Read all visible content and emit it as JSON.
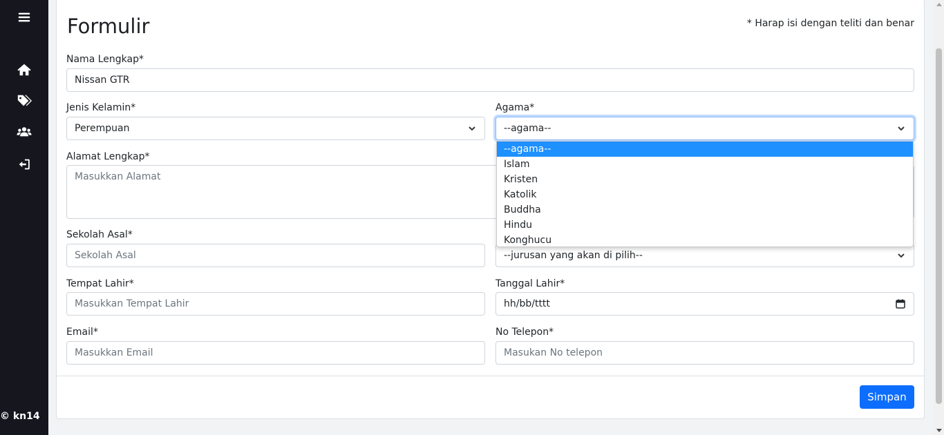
{
  "sidebar": {
    "icons": [
      "menu-icon",
      "home-icon",
      "tags-icon",
      "users-icon",
      "logout-icon"
    ],
    "copyright": "© kn14"
  },
  "form": {
    "title": "Formulir",
    "note": "* Harap isi dengan teliti dan benar",
    "nama": {
      "label": "Nama Lengkap*",
      "value": "Nissan GTR"
    },
    "jenis_kelamin": {
      "label": "Jenis Kelamin*",
      "value": "Perempuan"
    },
    "agama": {
      "label": "Agama*",
      "value": "--agama--",
      "options": [
        "--agama--",
        "Islam",
        "Kristen",
        "Katolik",
        "Buddha",
        "Hindu",
        "Konghucu"
      ],
      "selected_index": 0
    },
    "alamat": {
      "label": "Alamat Lengkap*",
      "placeholder": "Masukkan Alamat"
    },
    "sekolah": {
      "label": "Sekolah Asal*",
      "placeholder": "Sekolah Asal"
    },
    "jurusan": {
      "value": "--jurusan yang akan di pilih--"
    },
    "tempat_lahir": {
      "label": "Tempat Lahir*",
      "placeholder": "Masukkan Tempat Lahir"
    },
    "tanggal_lahir": {
      "label": "Tanggal Lahir*",
      "value": "hh/bb/tttt"
    },
    "email": {
      "label": "Email*",
      "placeholder": "Masukkan Email"
    },
    "telepon": {
      "label": "No Telepon*",
      "placeholder": "Masukan No telepon"
    },
    "submit_label": "Simpan"
  },
  "colors": {
    "sidebar_bg": "#16161f",
    "primary": "#0d6efd",
    "dropdown_highlight": "#1e90ff"
  }
}
